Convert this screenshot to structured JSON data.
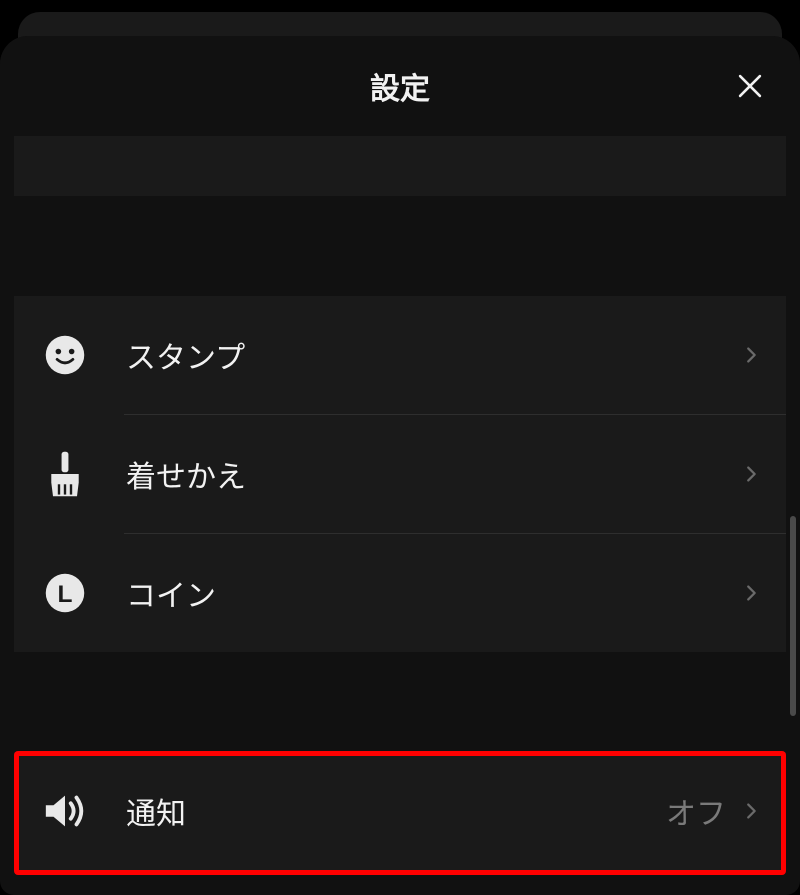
{
  "header": {
    "title": "設定"
  },
  "sections": {
    "shop": {
      "items": [
        {
          "label": "スタンプ",
          "icon": "smiley"
        },
        {
          "label": "着せかえ",
          "icon": "brush"
        },
        {
          "label": "コイン",
          "icon": "coin-l"
        }
      ]
    },
    "general": {
      "items": [
        {
          "label": "通知",
          "value": "オフ",
          "icon": "speaker"
        }
      ]
    }
  }
}
